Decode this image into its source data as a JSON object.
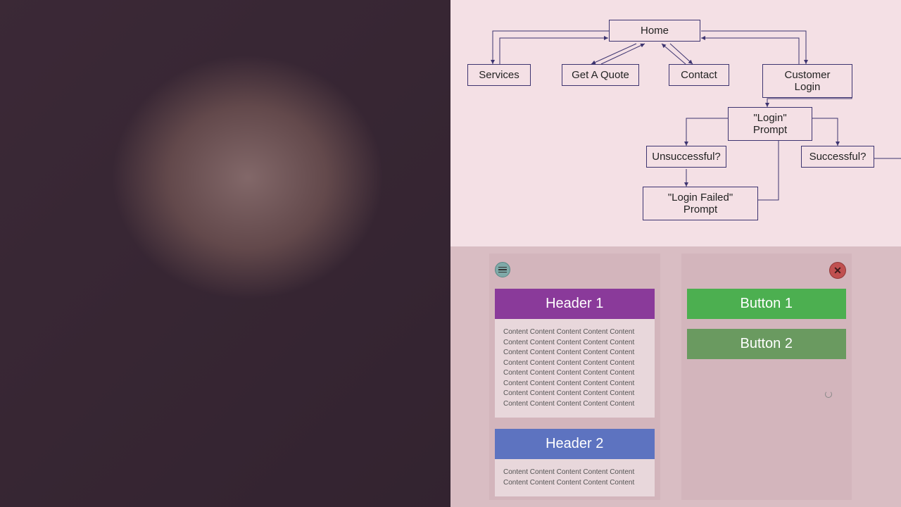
{
  "flowchart": {
    "nodes": {
      "home": "Home",
      "services": "Services",
      "get_quote": "Get A Quote",
      "contact": "Contact",
      "customer_login": "Customer Login",
      "login_prompt": "\"Login\" Prompt",
      "unsuccessful": "Unsuccessful?",
      "successful": "Successful?",
      "login_failed": "\"Login Failed\" Prompt"
    }
  },
  "wireframe_left": {
    "header1": "Header 1",
    "content1": "Content Content Content Content Content Content Content Content Content Content Content Content Content Content Content Content Content Content Content Content Content Content Content Content Content Content Content Content Content Content Content Content Content Content Content Content Content Content Content Content",
    "header2": "Header 2",
    "content2": "Content Content Content Content Content Content Content Content Content Content"
  },
  "wireframe_right": {
    "button1": "Button 1",
    "button2": "Button 2"
  }
}
